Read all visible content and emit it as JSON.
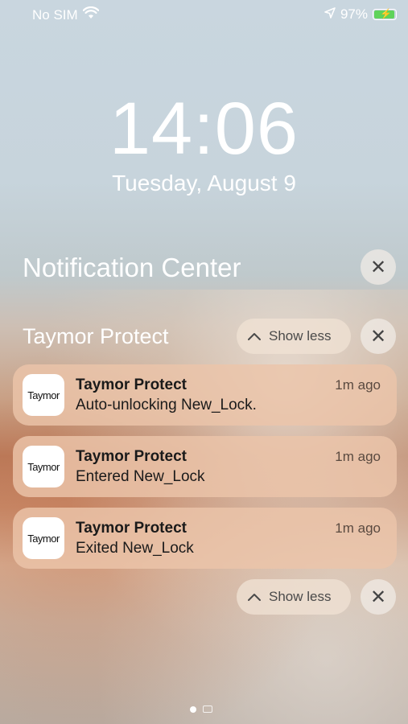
{
  "status": {
    "carrier": "No SIM",
    "battery": "97%",
    "icons": [
      "wifi-icon",
      "location-icon",
      "battery-charging-icon"
    ]
  },
  "lockscreen": {
    "time": "14:06",
    "date": "Tuesday, August 9"
  },
  "notification_center": {
    "title": "Notification Center"
  },
  "group": {
    "title": "Taymor Protect",
    "show_less_top": "Show less",
    "show_less_bottom": "Show less"
  },
  "notifications": [
    {
      "logo": "Taymor",
      "app": "Taymor Protect",
      "message": "Auto-unlocking New_Lock.",
      "time": "1m ago"
    },
    {
      "logo": "Taymor",
      "app": "Taymor Protect",
      "message": "Entered New_Lock",
      "time": "1m ago"
    },
    {
      "logo": "Taymor",
      "app": "Taymor Protect",
      "message": "Exited New_Lock",
      "time": "1m ago"
    }
  ],
  "colors": {
    "battery_fill": "#5fd35a",
    "card_bg": "#ecc4aa"
  }
}
